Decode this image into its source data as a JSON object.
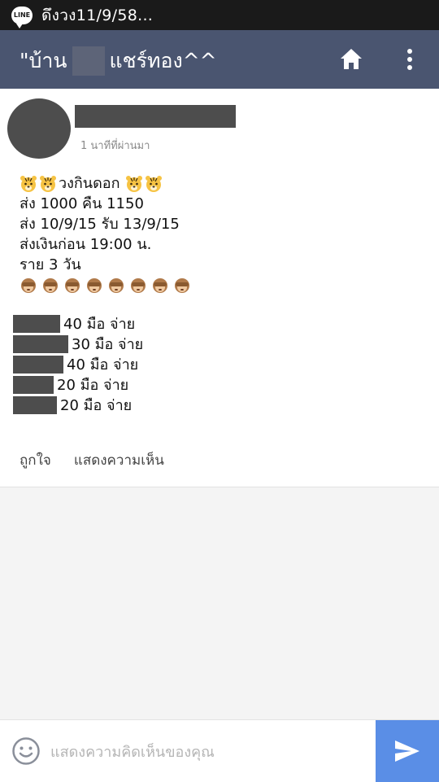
{
  "status_bar": {
    "app_icon_label": "LINE",
    "notification_text": "ดึงวง11/9/58..."
  },
  "app_bar": {
    "title_prefix": "\"บ้าน",
    "title_suffix": "แชร์ทอง^^"
  },
  "post": {
    "timestamp": "1 นาทีที่ผ่านมา",
    "heading_text": "วงกินดอก",
    "lines": [
      "ส่ง 1000 คืน 1150",
      "ส่ง 10/9/15 รับ 13/9/15",
      "ส่งเงินก่อน 19:00 น.",
      "ราย 3 วัน"
    ],
    "payments": [
      "40 มือ จ่าย",
      "30 มือ จ่าย",
      "40 มือ จ่าย",
      "20 มือ จ่าย",
      "20 มือ จ่าย"
    ]
  },
  "actions": {
    "like_label": "ถูกใจ",
    "comment_label": "แสดงความเห็น"
  },
  "composer": {
    "placeholder": "แสดงความคิดเห็นของคุณ",
    "value": ""
  },
  "colors": {
    "app_bar": "#4a5570",
    "send_button": "#5a8ee6",
    "redaction": "#4d4d4d"
  }
}
